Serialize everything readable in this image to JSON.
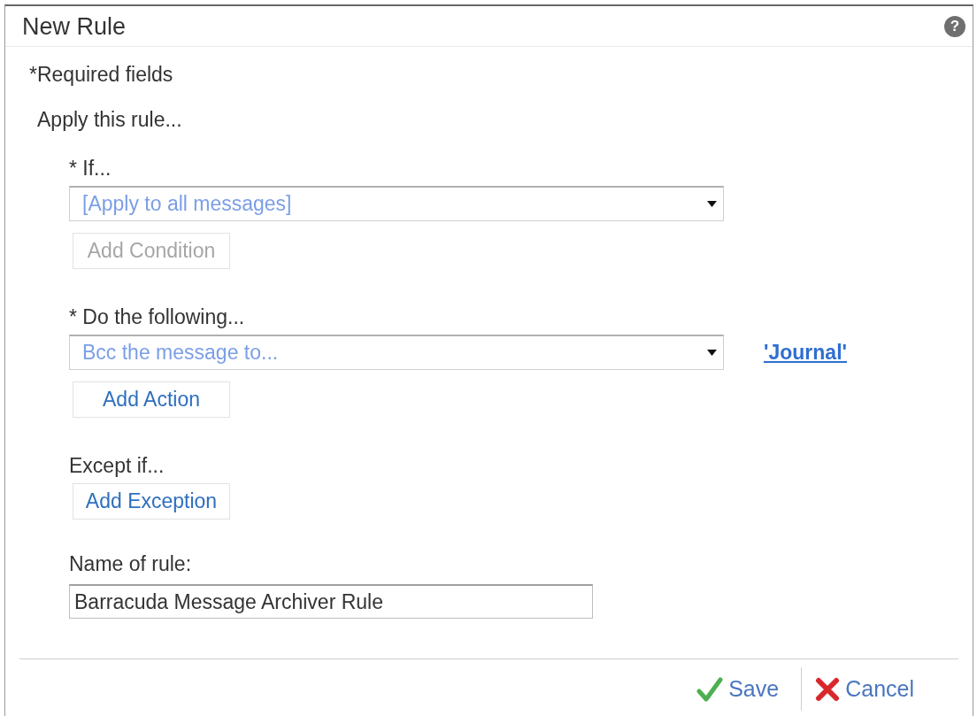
{
  "window": {
    "title": "New Rule",
    "help": "?"
  },
  "required_note": "*Required fields",
  "section": {
    "title": "Apply this rule...",
    "groups": [
      {
        "label": "* If...",
        "dropdown": {
          "value": "[Apply to all messages]"
        },
        "button": {
          "label": "Add Condition",
          "disabled": true
        }
      },
      {
        "label": "* Do the following...",
        "dropdown": {
          "value": "Bcc the message to..."
        },
        "link": "'Journal'",
        "button": {
          "label": "Add Action",
          "disabled": false
        }
      },
      {
        "label": "Except if...",
        "button": {
          "label": "Add Exception",
          "disabled": false
        }
      }
    ]
  },
  "rule_name": {
    "label": "Name of rule:",
    "value": "Barracuda Message Archiver Rule"
  },
  "footer": {
    "buttons": [
      {
        "kind": "save",
        "label": "Save"
      },
      {
        "kind": "cancel",
        "label": "Cancel"
      }
    ]
  }
}
